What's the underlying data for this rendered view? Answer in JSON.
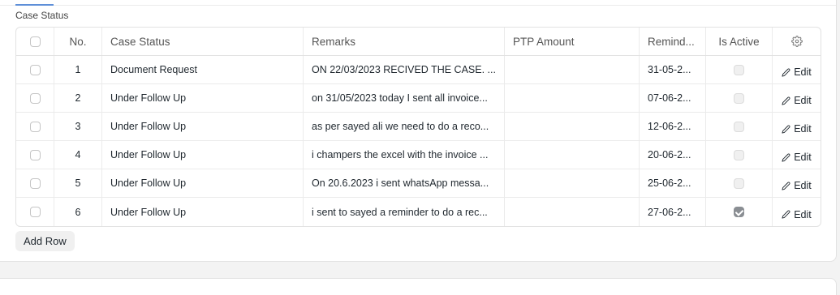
{
  "section": {
    "label": "Case Status"
  },
  "columns": {
    "no": "No.",
    "case_status": "Case Status",
    "remarks": "Remarks",
    "ptp_amount": "PTP Amount",
    "reminder": "Remind...",
    "is_active": "Is Active"
  },
  "rows": [
    {
      "no": "1",
      "case_status": "Document Request",
      "remarks": "ON 22/03/2023 RECIVED THE CASE. ...",
      "ptp_amount": "",
      "reminder": "31-05-2...",
      "is_active": false,
      "edit": "Edit"
    },
    {
      "no": "2",
      "case_status": "Under Follow Up",
      "remarks": "on 31/05/2023 today I sent all invoice...",
      "ptp_amount": "",
      "reminder": "07-06-2...",
      "is_active": false,
      "edit": "Edit"
    },
    {
      "no": "3",
      "case_status": "Under Follow Up",
      "remarks": "as per sayed ali we need to do a reco...",
      "ptp_amount": "",
      "reminder": "12-06-2...",
      "is_active": false,
      "edit": "Edit"
    },
    {
      "no": "4",
      "case_status": "Under Follow Up",
      "remarks": "i champers the excel with the invoice ...",
      "ptp_amount": "",
      "reminder": "20-06-2...",
      "is_active": false,
      "edit": "Edit"
    },
    {
      "no": "5",
      "case_status": "Under Follow Up",
      "remarks": "On 20.6.2023 i sent whatsApp messa...",
      "ptp_amount": "",
      "reminder": "25-06-2...",
      "is_active": false,
      "edit": "Edit"
    },
    {
      "no": "6",
      "case_status": "Under Follow Up",
      "remarks": "i sent to sayed a reminder to do a rec...",
      "ptp_amount": "",
      "reminder": "27-06-2...",
      "is_active": true,
      "edit": "Edit"
    }
  ],
  "actions": {
    "add_row": "Add Row"
  },
  "icons": {
    "settings": "gear-icon",
    "edit": "pencil-icon"
  }
}
